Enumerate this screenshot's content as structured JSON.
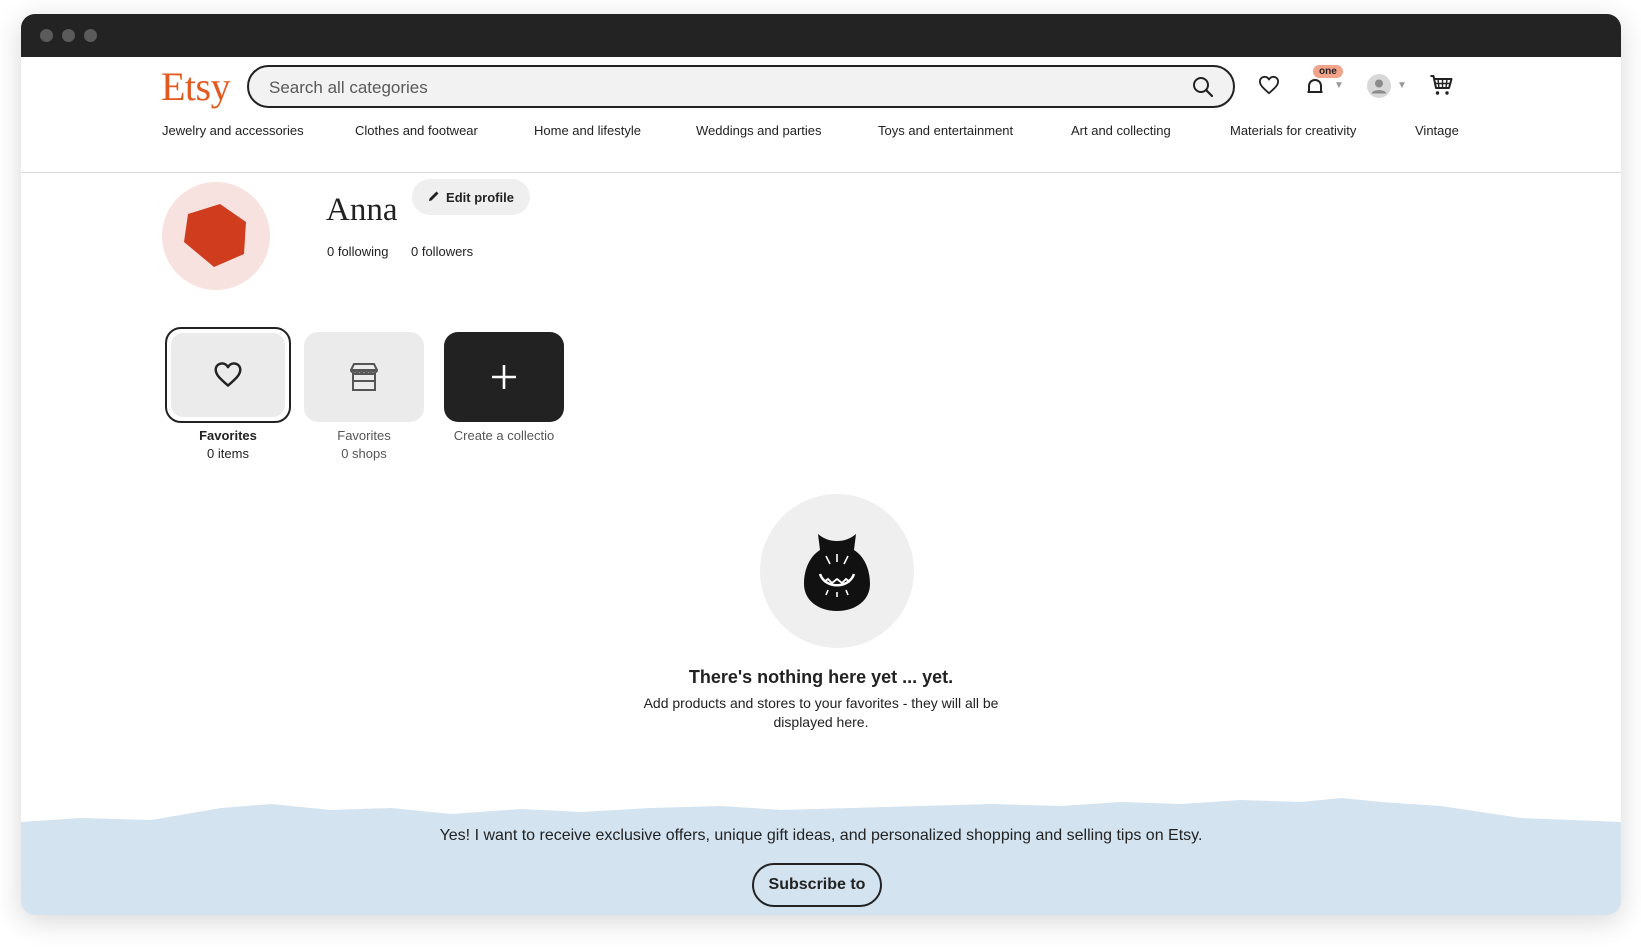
{
  "header": {
    "logo": "Etsy",
    "search_placeholder": "Search all categories",
    "notification_badge": "one"
  },
  "nav": {
    "items": [
      "Jewelry and accessories",
      "Clothes and footwear",
      "Home and lifestyle",
      "Weddings and parties",
      "Toys and entertainment",
      "Art and collecting",
      "Materials for creativity",
      "Vintage"
    ]
  },
  "profile": {
    "name": "Anna",
    "edit_label": "Edit profile",
    "following": "0 following",
    "followers": "0 followers"
  },
  "collections": [
    {
      "title": "Favorites",
      "subtitle": "0 items"
    },
    {
      "title": "Favorites",
      "subtitle": "0 shops"
    },
    {
      "title": "Create a collectio",
      "subtitle": ""
    }
  ],
  "empty_state": {
    "title": "There's nothing here yet ... yet.",
    "text": "Add products and stores to your favorites - they will all be displayed here."
  },
  "footer": {
    "text": "Yes! I want to receive exclusive offers, unique gift ideas, and personalized shopping and selling tips on Etsy.",
    "subscribe_label": "Subscribe to"
  },
  "colors": {
    "brand": "#e35a21",
    "avatar_bg": "#f7e2df",
    "avatar_shape": "#d03c1e",
    "footer_bg": "#d3e3f0"
  }
}
